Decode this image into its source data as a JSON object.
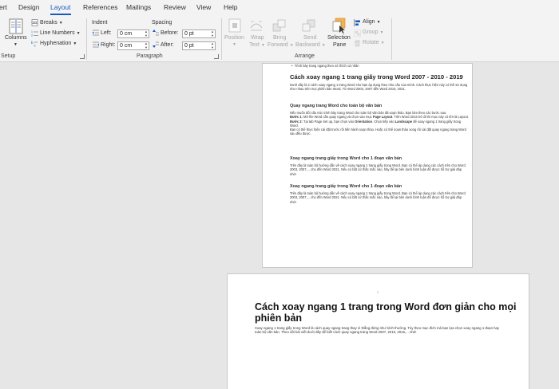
{
  "tabs": [
    {
      "label": "ert",
      "active": false
    },
    {
      "label": "Design",
      "active": false
    },
    {
      "label": "Layout",
      "active": true
    },
    {
      "label": "References",
      "active": false
    },
    {
      "label": "Mailings",
      "active": false
    },
    {
      "label": "Review",
      "active": false
    },
    {
      "label": "View",
      "active": false
    },
    {
      "label": "Help",
      "active": false
    }
  ],
  "page_setup": {
    "columns_label": "Columns",
    "breaks_label": "Breaks",
    "line_numbers_label": "Line Numbers",
    "hyphenation_label": "Hyphenation",
    "group_label": "Setup"
  },
  "paragraph": {
    "indent_header": "Indent",
    "spacing_header": "Spacing",
    "left_label": "Left:",
    "left_value": "0 cm",
    "right_label": "Right:",
    "right_value": "0 cm",
    "before_label": "Before:",
    "before_value": "0 pt",
    "after_label": "After:",
    "after_value": "0 pt",
    "group_label": "Paragraph"
  },
  "arrange": {
    "position_label": "Position",
    "wrap_label_1": "Wrap",
    "wrap_label_2": "Text",
    "bring_label_1": "Bring",
    "bring_label_2": "Forward",
    "send_label_1": "Send",
    "send_label_2": "Backward",
    "selection_label_1": "Selection",
    "selection_label_2": "Pane",
    "align_label": "Align",
    "group_btn_label": "Group",
    "rotate_label": "Rotate",
    "group_label": "Arrange"
  },
  "colors": {
    "accent": "#185abd",
    "ribbon_bg": "#f3f3f3",
    "canvas_bg": "#e6e6e6",
    "disabled": "#a6a6a6"
  },
  "doc1": {
    "bullet": "Trình bày trang ngang theo sở thích cá nhân",
    "title": "Cách xoay ngang 1 trang giấy trong Word 2007 - 2010 - 2019",
    "intro": "Dưới đây là 2 cách xoay ngang 1 trang Word cho bạn áp dụng theo nhu cầu của mình. Cách thực hiện này có thể sử dụng như nhau trên mọi phiên bản Word, Từ Word 2003, 2007 đến Word 2010, 2021.",
    "section1_heading": "Quay ngang trang Word cho toàn bộ văn bản",
    "section1_intro": "Nếu muốn đổi cấu trúc trình bày trang Word cho toàn bộ văn bản đã soạn thảo. Bạn làm theo các bước sau:",
    "step1_label": "Bước 1:",
    "step1_text_a": " Mở file Word cần quay ngang và chọn vào mục ",
    "step1_bold": "Page Layout",
    "step1_text_b": ". Trên Word 2016 trở đi thì mục này có tên là Layout.",
    "step2_label": "Bước 2:",
    "step2_text_a": " Tại tab Page Set up, bạn chọn vào ",
    "step2_bold1": "Orientation",
    "step2_text_b": ". Chọn tiếp vào ",
    "step2_bold2": "Landscape",
    "step2_text_c": " để xoay ngang 1 trang giấy trong Word.",
    "section1_outro": "Bạn có thể thực hiện cài đặt trước rồi tiến hành soạn thảo. Hoặc có thể soạn thảo xong rồi cài đặt quay ngang trang Word sau đều được.",
    "section2_heading": "Xoay ngang trang giấy trong Word cho 1 đoạn văn bản",
    "section2_text": "Trên đây là toàn bộ hướng dẫn về cách xoay ngang 1 trang giấy trong Word. Bạn có thể áp dụng các cách trên cho Word 2003, 2007,... cho đến Word 2021. Nếu có bất cứ thắc mắc nào, hãy để lại bên dưới bình luận để được hỗ trợ giải đáp nhé!",
    "section3_heading": "Xoay ngang trang giấy trong Word cho 1 đoạn văn bản",
    "section3_text": "Trên đây là toàn bộ hướng dẫn về cách xoay ngang 1 trang giấy trong Word. Bạn có thể áp dụng các cách trên cho Word 2003, 2007,... cho đến Word 2021. Nếu có bất cứ thắc mắc nào, hãy để lại bên dưới bình luận để được hỗ trợ giải đáp nhé!"
  },
  "doc2": {
    "page_number": "2",
    "title": "Cách xoay ngang 1 trang trong Word đơn giản cho mọi phiên bản",
    "para": "Xoay ngang 1 trang giấy trong Word là cách quay ngang trang thay vì thẳng đứng như bình thường. Tùy theo mục đích mà bạn lựa chọn xoay ngang 1 đoạn hay toàn bộ văn bản. Theo dõi bài viết dưới đây để biết cách quay ngang trang Word 2007, 2010, 2016,... nhé!"
  }
}
